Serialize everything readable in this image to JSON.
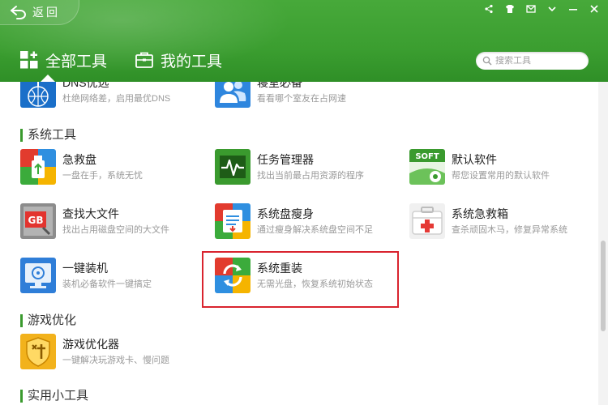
{
  "header": {
    "back_label": "返回",
    "tabs": [
      {
        "label": "全部工具",
        "icon": "grid-plus-icon",
        "active": true
      },
      {
        "label": "我的工具",
        "icon": "toolbox-icon",
        "active": false
      }
    ],
    "search_placeholder": "搜索工具",
    "window_controls": [
      "share-icon",
      "skin-icon",
      "message-icon",
      "menu-icon",
      "minimize-icon",
      "close-icon"
    ]
  },
  "colors": {
    "brand_green": "#3b9e30",
    "section_bar": "#3a9a2e",
    "highlight": "#d9232e"
  },
  "network_tools": [
    {
      "name": "DNS优选",
      "desc": "杜绝网络差，启用最优DNS",
      "icon": "dns-tower-icon"
    },
    {
      "name": "寝室必备",
      "desc": "看看哪个室友在占网速",
      "icon": "users-icon"
    }
  ],
  "sections": {
    "system": "系统工具",
    "game": "游戏优化",
    "utility": "实用小工具"
  },
  "system_tools": [
    {
      "name": "急救盘",
      "desc": "一盘在手，系统无忧",
      "icon": "usb-rescue-icon"
    },
    {
      "name": "任务管理器",
      "desc": "找出当前最占用资源的程序",
      "icon": "task-monitor-icon"
    },
    {
      "name": "默认软件",
      "desc": "帮您设置常用的默认软件",
      "icon": "soft-settings-icon"
    },
    {
      "name": "查找大文件",
      "desc": "找出占用磁盘空间的大文件",
      "icon": "gb-file-icon"
    },
    {
      "name": "系统盘瘦身",
      "desc": "通过瘦身解决系统盘空间不足",
      "icon": "disk-slim-icon"
    },
    {
      "name": "系统急救箱",
      "desc": "查杀顽固木马，修复异常系统",
      "icon": "first-aid-icon"
    },
    {
      "name": "一键装机",
      "desc": "装机必备软件一键搞定",
      "icon": "monitor-install-icon"
    },
    {
      "name": "系统重装",
      "desc": "无需光盘，恢复系统初始状态",
      "icon": "system-reinstall-icon"
    }
  ],
  "game_tools": [
    {
      "name": "游戏优化器",
      "desc": "一键解决玩游戏卡、慢问题",
      "icon": "game-shield-icon"
    }
  ]
}
